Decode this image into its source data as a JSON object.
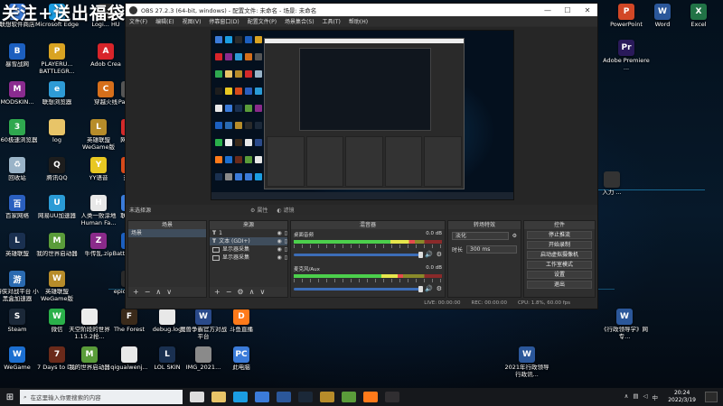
{
  "overlay_title": "关注+送出福袋",
  "desktop_left_icons": [
    {
      "label": "联想软件商店",
      "color": "#3b7bd9",
      "glyph": "S"
    },
    {
      "label": "Microsoft Edge",
      "color": "#1b9de2",
      "glyph": "e"
    },
    {
      "label": "Logi... HU",
      "color": "#2a2a2a",
      "glyph": "L"
    },
    {
      "label": "暴雪战网",
      "color": "#1c5fbf",
      "glyph": "B"
    },
    {
      "label": "PLAYERU... BATTLEGR...",
      "color": "#d9a322",
      "glyph": "P"
    },
    {
      "label": "Adob Crea",
      "color": "#d8242a",
      "glyph": "A"
    },
    {
      "label": "MODSKIN...",
      "color": "#8a2b8f",
      "glyph": "M"
    },
    {
      "label": "联想浏览器",
      "color": "#2e9bd6",
      "glyph": "e"
    },
    {
      "label": "穿越火线",
      "color": "#d66f1b",
      "glyph": "C"
    },
    {
      "label": "Pa Anin",
      "color": "#555",
      "glyph": "P"
    },
    {
      "label": "360极速浏览器",
      "color": "#2fa84f",
      "glyph": "3"
    },
    {
      "label": "log",
      "color": "#e8c468",
      "glyph": ""
    },
    {
      "label": "英雄联盟WeGame版",
      "color": "#b78c2a",
      "glyph": "L"
    },
    {
      "label": "网易云",
      "color": "#d32a2a",
      "glyph": "N"
    },
    {
      "label": "回收站",
      "color": "#9ab4c8",
      "glyph": "♻"
    },
    {
      "label": "腾讯QQ",
      "color": "#1d1d1d",
      "glyph": "Q"
    },
    {
      "label": "YY语音",
      "color": "#e8c822",
      "glyph": "Y"
    },
    {
      "label": "迅游",
      "color": "#d64a1b",
      "glyph": "X"
    },
    {
      "label": "百家网络",
      "color": "#2a5fbf",
      "glyph": "百"
    },
    {
      "label": "网易UU加速器",
      "color": "#2a9bd6",
      "glyph": "U"
    },
    {
      "label": "人类一败涂地 Human Fa...",
      "color": "#e8e8e8",
      "glyph": "H"
    },
    {
      "label": "联想电",
      "color": "#3b7bd9",
      "glyph": "L"
    },
    {
      "label": "英雄联盟",
      "color": "#1a3050",
      "glyph": "L"
    },
    {
      "label": "我的世界启动器",
      "color": "#5a9c3a",
      "glyph": "M"
    },
    {
      "label": "牛传乱.zip",
      "color": "#8a2a8a",
      "glyph": "Z"
    },
    {
      "label": "Battle Gam",
      "color": "#1c5fbf",
      "glyph": "B"
    },
    {
      "label": "游侠对战平台 小黑盒加速器",
      "color": "#2a6ab0",
      "glyph": "游"
    },
    {
      "label": "英雄联盟 WeGame版",
      "color": "#b78c2a",
      "glyph": "W"
    },
    {
      "label": "epic @280",
      "color": "#2a2a2a",
      "glyph": "E"
    },
    {
      "label": "Steam",
      "color": "#1b2838",
      "glyph": "S"
    },
    {
      "label": "微信",
      "color": "#2ab04a",
      "glyph": "W"
    },
    {
      "label": "天空阶段的世界1.15.2抢...",
      "color": "#ececec",
      "glyph": ""
    },
    {
      "label": "The Forest",
      "color": "#3a2a1a",
      "glyph": "F"
    },
    {
      "label": "debug.log",
      "color": "#e8e8e8",
      "glyph": ""
    },
    {
      "label": "魔兽争霸官方对战平台",
      "color": "#2a4a8a",
      "glyph": "W"
    },
    {
      "label": "斗鱼直播",
      "color": "#ff7a1a",
      "glyph": "D"
    },
    {
      "label": "WeGame",
      "color": "#1c6fd0",
      "glyph": "W"
    },
    {
      "label": "7 Days to Die",
      "color": "#6a2a1a",
      "glyph": "7"
    },
    {
      "label": "我的世界启动器",
      "color": "#5a9c3a",
      "glyph": "M"
    },
    {
      "label": "qiguaiwenj...",
      "color": "#e8e8e8",
      "glyph": ""
    },
    {
      "label": "LOL SKIN",
      "color": "#1a3050",
      "glyph": "L"
    },
    {
      "label": "IMG_2021...",
      "color": "#8a8a8a",
      "glyph": ""
    },
    {
      "label": "此电脑",
      "color": "#3b7bd9",
      "glyph": "PC"
    }
  ],
  "desktop_right_icons": [
    {
      "label": "PowerPoint",
      "color": "#d24726",
      "glyph": "P"
    },
    {
      "label": "Word",
      "color": "#2b579a",
      "glyph": "W"
    },
    {
      "label": "Excel",
      "color": "#217346",
      "glyph": "X"
    },
    {
      "label": "Adobe Premiere ...",
      "color": "#2a1a5a",
      "glyph": "Pr"
    },
    {
      "label": "入力 ...",
      "color": "#333",
      "glyph": ""
    },
    {
      "label": "《行政领导学》网专...",
      "color": "#2b579a",
      "glyph": "W"
    },
    {
      "label": "2021年行政领导行政讯...",
      "color": "#2b579a",
      "glyph": "W"
    }
  ],
  "obs": {
    "title": "OBS 27.2.3 (64-bit, windows) - 配置文件: 未命名 - 场景: 未命名",
    "menu": [
      "文件(F)",
      "编辑(E)",
      "视图(V)",
      "停靠窗口(D)",
      "配置文件(P)",
      "场景集合(S)",
      "工具(T)",
      "帮助(H)"
    ],
    "scene_toolbar": {
      "label": "未选择源",
      "props": "属性",
      "filters": "滤镜"
    },
    "docks": {
      "scenes": {
        "title": "场景",
        "items": [
          "场景"
        ]
      },
      "sources": {
        "title": "来源",
        "items": [
          "1",
          "文本 (GDI+)",
          "显示器采集",
          "显示器采集"
        ]
      },
      "mixer": {
        "title": "混音器",
        "tracks": [
          {
            "name": "桌面音频",
            "db": "0.0 dB",
            "level": 0.82
          },
          {
            "name": "麦克风/Aux",
            "db": "0.0 dB",
            "level": 0.74
          }
        ]
      },
      "transitions": {
        "title": "转场特效",
        "type": "淡化",
        "duration_label": "时长",
        "duration": "300 ms"
      },
      "controls": {
        "title": "控件",
        "buttons": [
          "停止推流",
          "开始录制",
          "启动虚拟摄像机",
          "工作室模式",
          "设置",
          "退出"
        ]
      }
    },
    "status": {
      "live": "LIVE: 00:00:00",
      "rec": "REC: 00:00:00",
      "cpu": "CPU: 1.8%, 60.00 fps"
    }
  },
  "taskbar": {
    "search_placeholder": "在这里输入你要搜索的内容",
    "time": "20:24",
    "date": "2022/3/19",
    "lang": "中",
    "apps": [
      {
        "name": "task-view",
        "color": "#ddd"
      },
      {
        "name": "file-explorer",
        "color": "#e8c468"
      },
      {
        "name": "edge",
        "color": "#1b9de2"
      },
      {
        "name": "store",
        "color": "#3b7bd9"
      },
      {
        "name": "mail",
        "color": "#2b579a"
      },
      {
        "name": "steam",
        "color": "#1b2838"
      },
      {
        "name": "lol",
        "color": "#b78c2a"
      },
      {
        "name": "minecraft",
        "color": "#5a9c3a"
      },
      {
        "name": "douyu",
        "color": "#ff7a1a"
      },
      {
        "name": "obs",
        "color": "#302e31"
      }
    ]
  }
}
